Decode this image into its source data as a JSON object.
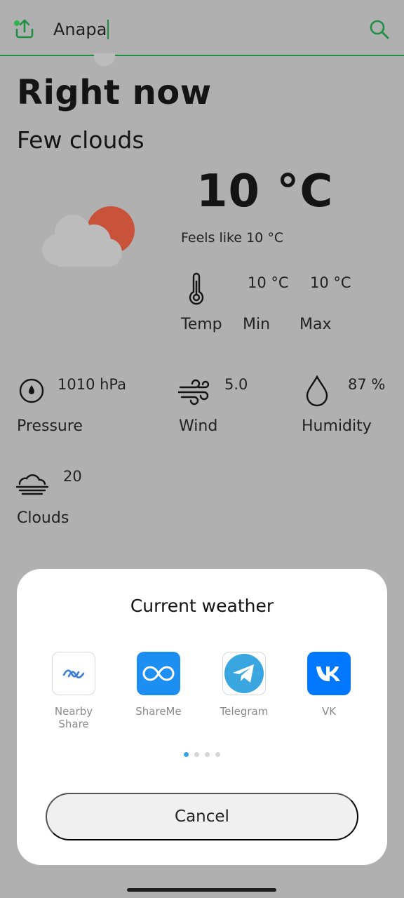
{
  "search": {
    "value": "Anapa"
  },
  "current": {
    "heading": "Right now",
    "description": "Few clouds",
    "temperature": "10 °C",
    "feels_like": "Feels like 10 °C",
    "temp_label": "Temp",
    "min_value": "10 °C",
    "max_value": "10 °C",
    "min_label": "Min",
    "max_label": "Max"
  },
  "details": {
    "pressure": {
      "value": "1010 hPa",
      "label": "Pressure"
    },
    "wind": {
      "value": "5.0",
      "label": "Wind"
    },
    "humidity": {
      "value": "87 %",
      "label": "Humidity"
    },
    "clouds": {
      "value": "20",
      "label": "Clouds"
    }
  },
  "share_sheet": {
    "title": "Current weather",
    "apps": [
      {
        "label": "Nearby Share",
        "icon": "nearby-share-icon"
      },
      {
        "label": "ShareMe",
        "icon": "shareme-icon"
      },
      {
        "label": "Telegram",
        "icon": "telegram-icon"
      },
      {
        "label": "VK",
        "icon": "vk-icon"
      }
    ],
    "page_count": 4,
    "active_page": 1,
    "cancel_label": "Cancel"
  },
  "colors": {
    "accent_green": "#1f8f44",
    "sun": "#c9533a",
    "cloud": "#bdbcbd",
    "scrim_background": "#b1b0b1",
    "shareme_blue": "#1e8ff2",
    "telegram_blue": "#39a6e0",
    "vk_blue": "#0077ff"
  }
}
